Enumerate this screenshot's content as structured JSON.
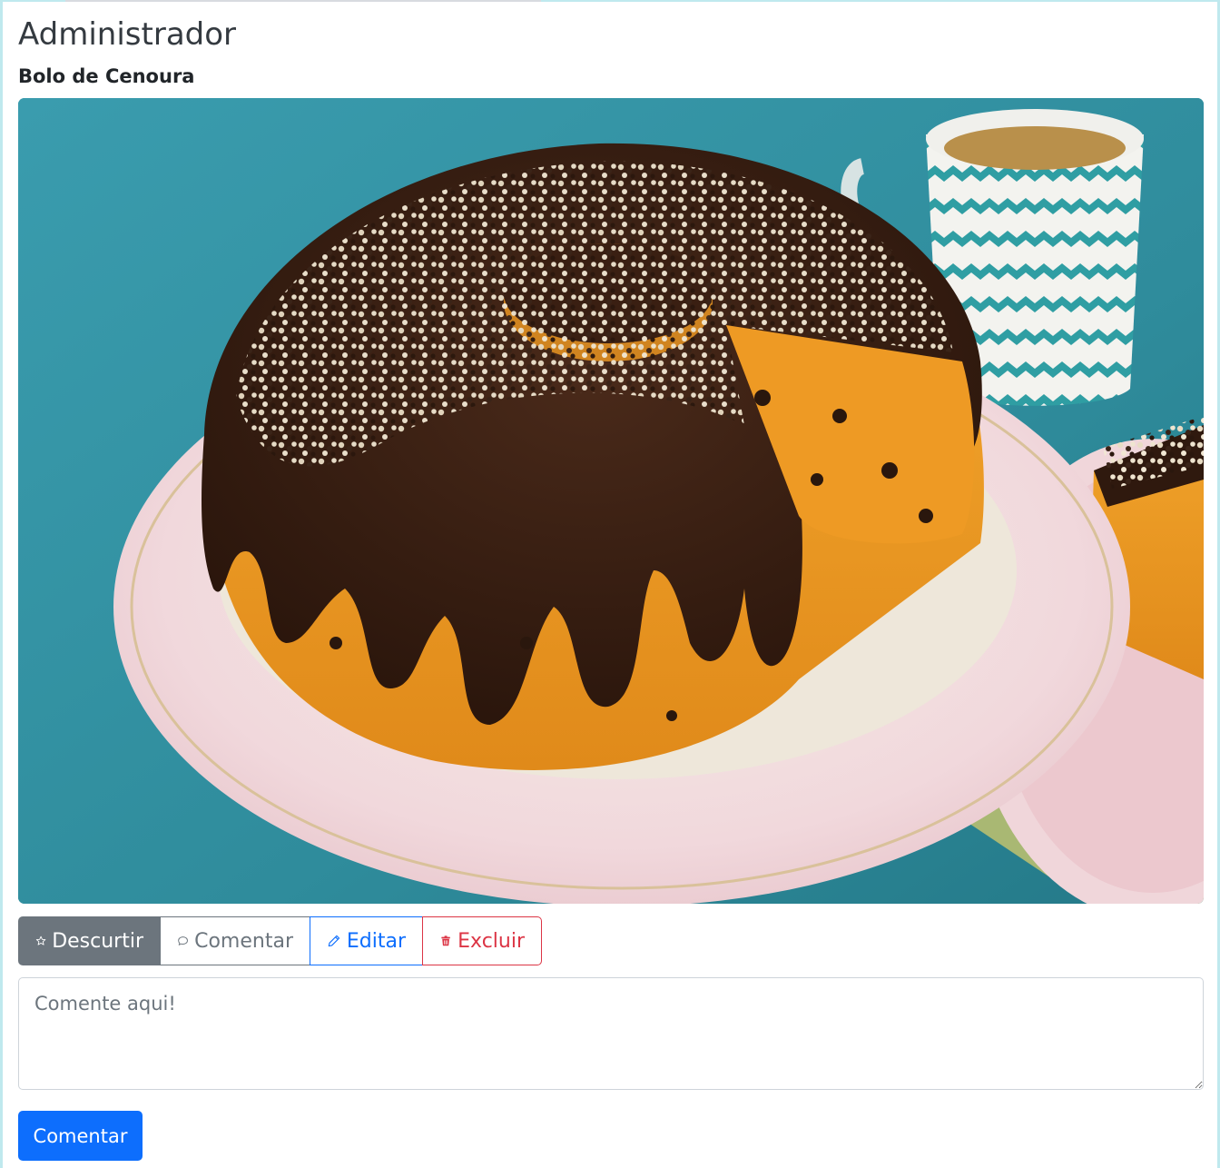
{
  "header": {
    "user_name": "Administrador"
  },
  "post": {
    "title": "Bolo de Cenoura",
    "image_description": "carrot-cake-with-chocolate-frosting-photo"
  },
  "actions": {
    "like_label": "Descurtir",
    "comment_label": "Comentar",
    "edit_label": "Editar",
    "delete_label": "Excluir"
  },
  "comment_form": {
    "placeholder": "Comente aqui!",
    "value": "",
    "submit_label": "Comentar"
  },
  "colors": {
    "secondary": "#6c757d",
    "primary": "#0d6efd",
    "danger": "#dc3545",
    "frame_border": "#bfe9ee"
  },
  "icons": {
    "like": "star-icon",
    "comment": "chat-bubble-icon",
    "edit": "pencil-icon",
    "delete": "trash-icon"
  }
}
